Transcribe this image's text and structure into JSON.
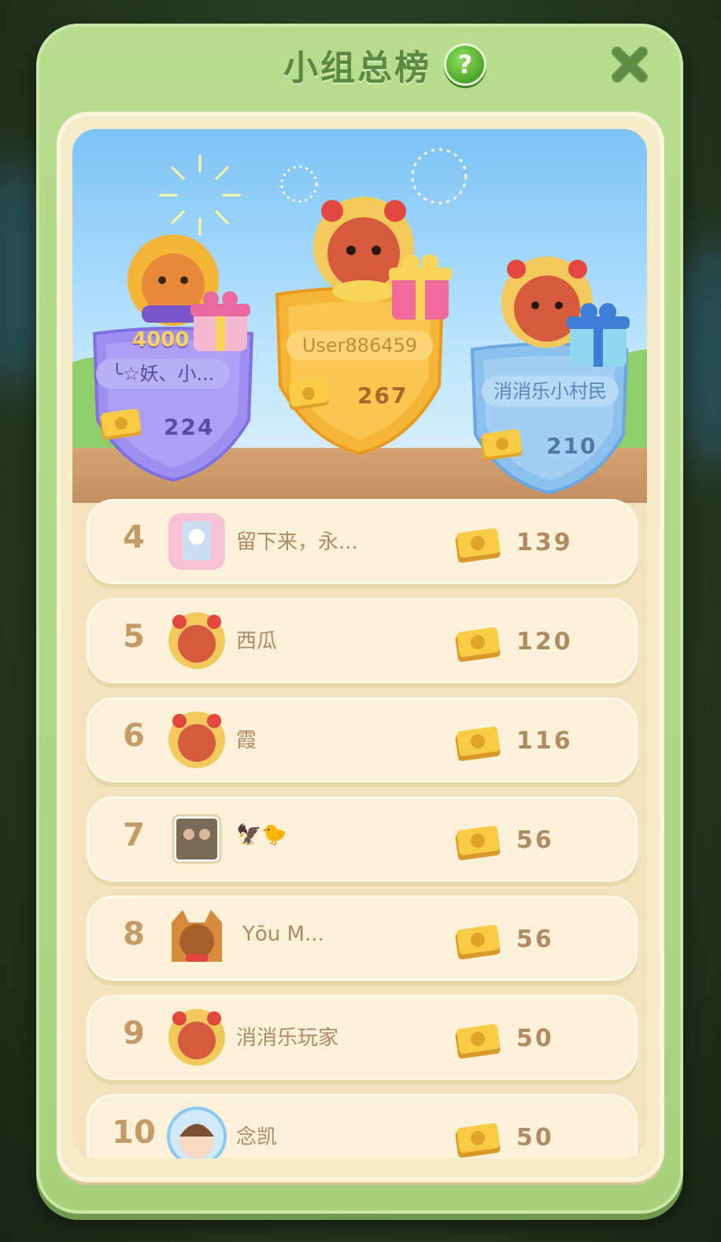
{
  "header": {
    "title": "小组总榜",
    "help_icon": "question-mark-icon",
    "close_icon": "close-x-icon"
  },
  "colors": {
    "panel_green": "#a8d17e",
    "title_green": "#5b8942",
    "cream": "#f6ebc9",
    "row_text": "#b08a63",
    "rank_text": "#c49a66",
    "first_place_gold": "#f5b536",
    "second_place_purple": "#9d8ef0",
    "third_place_blue": "#8cc1ee"
  },
  "podium": {
    "first": {
      "name": "User886459",
      "score": "267"
    },
    "second": {
      "name": "╰☆妖、小...",
      "score": "224",
      "badge_text": "4000"
    },
    "third": {
      "name": "消消乐小村民",
      "score": "210"
    }
  },
  "leaderboard": [
    {
      "rank": "4",
      "name": "留下来，永...",
      "score": "139"
    },
    {
      "rank": "5",
      "name": "西瓜",
      "score": "120"
    },
    {
      "rank": "6",
      "name": "霞",
      "score": "116"
    },
    {
      "rank": "7",
      "name": "🦅🐤",
      "score": "56"
    },
    {
      "rank": "8",
      "name": "Yōu M...",
      "score": "56"
    },
    {
      "rank": "9",
      "name": "消消乐玩家",
      "score": "50"
    },
    {
      "rank": "10",
      "name": "念凯",
      "score": "50"
    }
  ]
}
